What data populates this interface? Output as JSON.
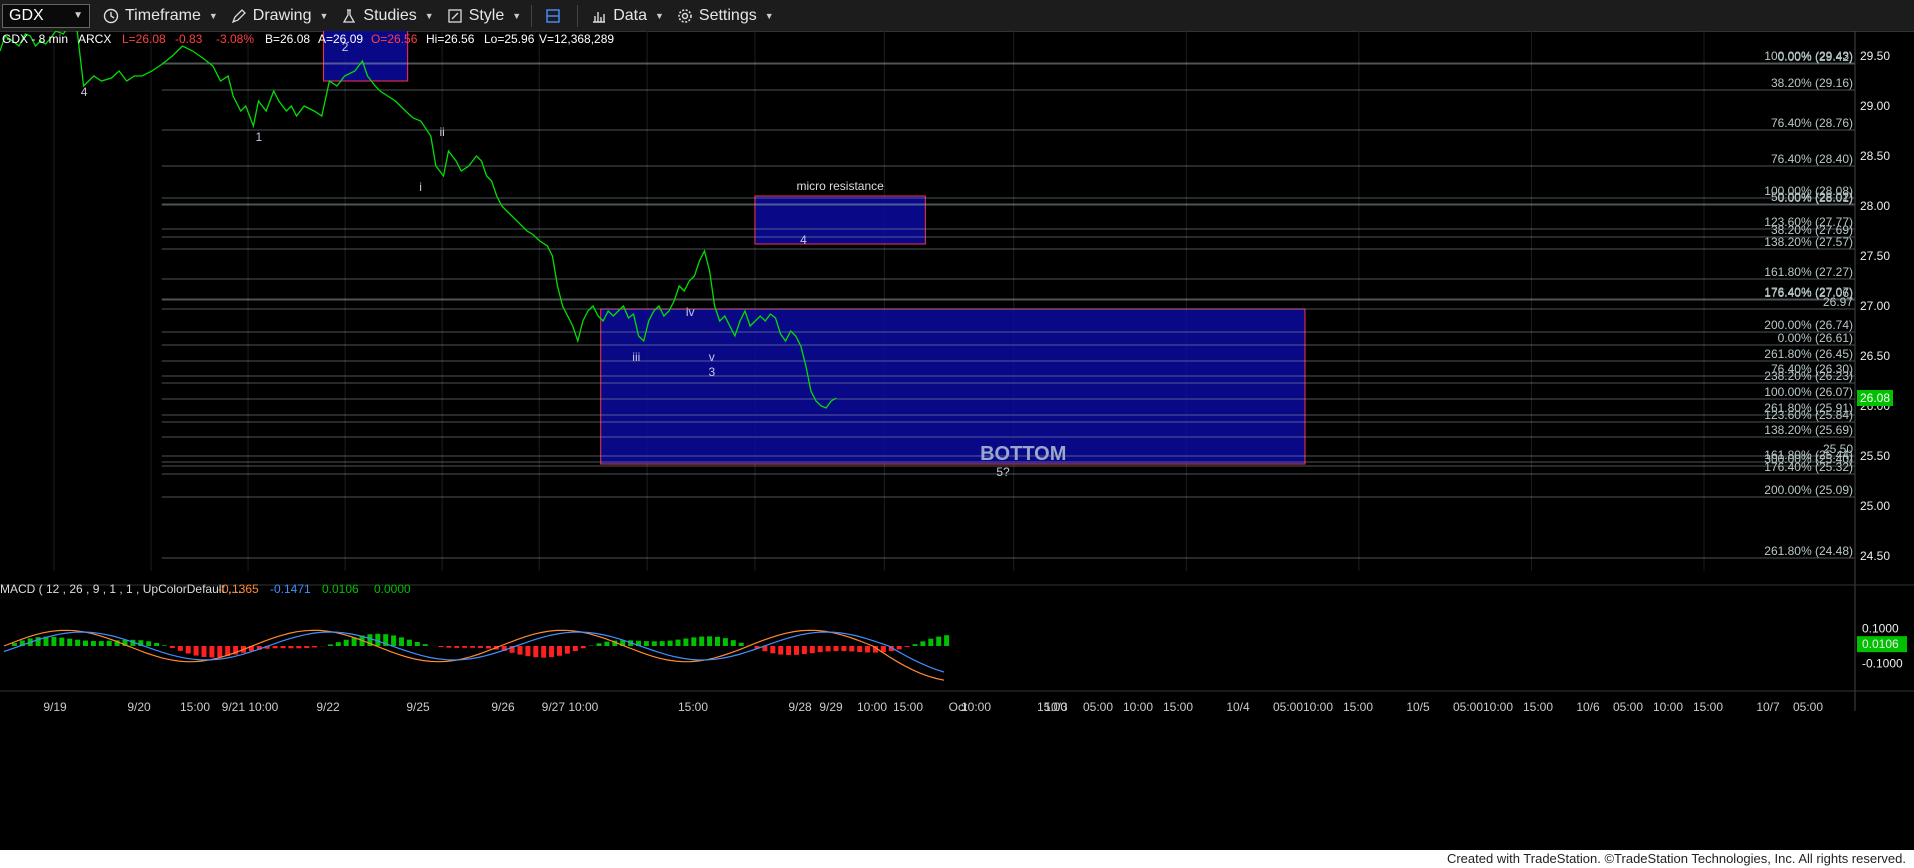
{
  "toolbar": {
    "symbol": "GDX",
    "timeframe_label": "Timeframe",
    "drawing_label": "Drawing",
    "studies_label": "Studies",
    "style_label": "Style",
    "data_label": "Data",
    "settings_label": "Settings",
    "icons": [
      "clock-icon",
      "pencil-icon",
      "flask-icon",
      "style-icon",
      "layout-icon",
      "bar-chart-icon",
      "gear-icon"
    ]
  },
  "header": {
    "symbol_interval": "GDX - 8 min",
    "exchange": "ARCX",
    "last": "L=26.08",
    "change": "-0.83",
    "change_pct": "-3.08%",
    "bid": "B=26.08",
    "ask": "A=26.09",
    "open": "O=26.56",
    "high": "Hi=26.56",
    "low": "Lo=25.96",
    "volume": "V=12,368,289"
  },
  "colors": {
    "price_line": "#00e000",
    "negative": "#ff4040",
    "box_fill": "#0a0aa0",
    "box_border": "#ff3050",
    "grid": "#1e1e1e",
    "last_tag": "#00c000",
    "macd_line": "#ff8a30",
    "signal_line": "#4090ff",
    "hist_pos": "#00c000",
    "hist_neg": "#ff2020"
  },
  "chart_data": {
    "type": "line",
    "title": "GDX - 8 min",
    "ylim": [
      24.35,
      29.75
    ],
    "y_ticks": [
      "29.50",
      "29.00",
      "28.50",
      "28.00",
      "27.50",
      "27.00",
      "26.50",
      "26.00",
      "25.50",
      "25.00",
      "24.50"
    ],
    "x_ticks": [
      "9/19",
      "9/20",
      "15:00",
      "9/21 10:00",
      "9/22",
      "9/25",
      "9/26",
      "9/27 10:00",
      "15:00",
      "9/28",
      "9/29",
      "10:00",
      "15:00",
      "Oct",
      "10:00",
      "15:00",
      "10/3",
      "05:00",
      "10:00",
      "15:00",
      "10/4",
      "05:00",
      "10:00",
      "15:00",
      "10/5",
      "05:00",
      "10:00",
      "15:00",
      "10/6",
      "05:00",
      "10:00",
      "15:00",
      "10/7",
      "05:00"
    ],
    "last_price_label": "26.08",
    "price_series": {
      "name": "GDX",
      "x": [
        0,
        0.02,
        0.05,
        0.075,
        0.1,
        0.12,
        0.14,
        0.16,
        0.18,
        0.2,
        0.22,
        0.25,
        0.27,
        0.3,
        0.33,
        0.37,
        0.4,
        0.44,
        0.47,
        0.5,
        0.53,
        0.56,
        0.6,
        0.64,
        0.68,
        0.72,
        0.76,
        0.8,
        0.84,
        0.87,
        0.9,
        0.92,
        0.95,
        0.97,
        1.0,
        1.02,
        1.05,
        1.08,
        1.1,
        1.13,
        1.15,
        1.17,
        1.2,
        1.24,
        1.27,
        1.3,
        1.33,
        1.36,
        1.4,
        1.43,
        1.45,
        1.48,
        1.5,
        1.53,
        1.56,
        1.58,
        1.6,
        1.63,
        1.66,
        1.7,
        1.72,
        1.75,
        1.77,
        1.8,
        1.82,
        1.85,
        1.88,
        1.9,
        1.92,
        1.94,
        1.96,
        1.98,
        2.0,
        2.02,
        2.04,
        2.06,
        2.08,
        2.1,
        2.13,
        2.16,
        2.18,
        2.2,
        2.22,
        2.24,
        2.26,
        2.28,
        2.3,
        2.32,
        2.34,
        2.36,
        2.38,
        2.4,
        2.42,
        2.44,
        2.46,
        2.48,
        2.5,
        2.52,
        2.54,
        2.56,
        2.58,
        2.6,
        2.62,
        2.64,
        2.66,
        2.68,
        2.7,
        2.72,
        2.74,
        2.76,
        2.78,
        2.8,
        2.82,
        2.84,
        2.86,
        2.88,
        2.9,
        2.92,
        2.94,
        2.96,
        2.98,
        3.0,
        3.02,
        3.04,
        3.06,
        3.08,
        3.1,
        3.12,
        3.14,
        3.16,
        3.18,
        3.2,
        3.22,
        3.24,
        3.26,
        3.28,
        3.3,
        3.32,
        3.34,
        3.36,
        3.38,
        3.4,
        3.42,
        3.44,
        3.46,
        3.48,
        3.5,
        3.52,
        3.54,
        3.56,
        3.58,
        3.6,
        3.62,
        3.64,
        3.66
      ],
      "y": [
        29.55,
        29.7,
        29.65,
        29.6,
        29.72,
        29.7,
        29.6,
        29.65,
        29.62,
        29.68,
        29.75,
        29.72,
        29.8,
        29.85,
        29.2,
        29.3,
        29.25,
        29.28,
        29.35,
        29.25,
        29.3,
        29.3,
        29.35,
        29.42,
        29.5,
        29.6,
        29.55,
        29.48,
        29.4,
        29.25,
        29.3,
        29.1,
        28.95,
        29.0,
        28.8,
        29.05,
        28.95,
        29.15,
        29.05,
        28.95,
        29.0,
        28.9,
        29.0,
        28.95,
        28.9,
        29.25,
        29.2,
        29.3,
        29.35,
        29.45,
        29.3,
        29.2,
        29.15,
        29.1,
        29.05,
        29.0,
        28.95,
        28.88,
        28.85,
        28.7,
        28.4,
        28.3,
        28.55,
        28.45,
        28.35,
        28.4,
        28.5,
        28.45,
        28.3,
        28.25,
        28.1,
        28.0,
        27.95,
        27.9,
        27.85,
        27.8,
        27.75,
        27.72,
        27.65,
        27.6,
        27.5,
        27.2,
        27.0,
        26.9,
        26.8,
        26.65,
        26.85,
        26.95,
        27.0,
        26.9,
        26.85,
        26.95,
        26.9,
        26.95,
        27.0,
        26.88,
        26.92,
        26.7,
        26.65,
        26.85,
        26.95,
        27.0,
        26.9,
        26.95,
        27.05,
        27.2,
        27.15,
        27.25,
        27.3,
        27.45,
        27.55,
        27.35,
        27.0,
        26.85,
        26.9,
        26.8,
        26.7,
        26.85,
        26.95,
        26.8,
        26.85,
        26.9,
        26.85,
        26.92,
        26.88,
        26.72,
        26.65,
        26.75,
        26.7,
        26.6,
        26.4,
        26.15,
        26.05,
        26.0,
        25.98,
        26.05,
        26.08
      ],
      "note_x": ""
    },
    "rectangles": [
      {
        "x0": 0.3,
        "x1": 0.378,
        "y0": 29.25,
        "y1": 29.85,
        "label": "2"
      },
      {
        "x0": 0.7,
        "x1": 0.858,
        "y0": 27.62,
        "y1": 28.1,
        "label": "micro resistance"
      },
      {
        "x0": 0.557,
        "x1": 1.21,
        "y0": 25.42,
        "y1": 26.97,
        "label": "BOTTOM"
      }
    ],
    "levels": [
      {
        "y": 29.43,
        "label": "100.00% (29.43)"
      },
      {
        "y": 29.42,
        "label": "0.00% (29.42)"
      },
      {
        "y": 29.16,
        "label": "38.20% (29.16)"
      },
      {
        "y": 28.76,
        "label": "76.40% (28.76)"
      },
      {
        "y": 28.4,
        "label": "76.40% (28.40)"
      },
      {
        "y": 28.01,
        "label": "0.00% (28.01)"
      },
      {
        "y": 28.08,
        "label": "100.00% (28.08)"
      },
      {
        "y": 28.02,
        "label": "50.00% (28.02)"
      },
      {
        "y": 27.77,
        "label": "123.60% (27.77)"
      },
      {
        "y": 27.69,
        "label": "38.20% (27.69)"
      },
      {
        "y": 27.57,
        "label": "138.20% (27.57)"
      },
      {
        "y": 27.27,
        "label": "161.80% (27.27)"
      },
      {
        "y": 27.07,
        "label": "176.40% (27.07)"
      },
      {
        "y": 27.06,
        "label": "176.40% (27.06)"
      },
      {
        "y": 26.97,
        "label": "26.97"
      },
      {
        "y": 26.74,
        "label": "200.00% (26.74)"
      },
      {
        "y": 26.61,
        "label": "0.00% (26.61)"
      },
      {
        "y": 26.45,
        "label": "261.80% (26.45)"
      },
      {
        "y": 26.3,
        "label": "76.40% (26.30)"
      },
      {
        "y": 26.23,
        "label": "238.20% (26.23)"
      },
      {
        "y": 26.07,
        "label": "100.00% (26.07)"
      },
      {
        "y": 25.91,
        "label": "261.80% (25.91)"
      },
      {
        "y": 25.84,
        "label": "123.60% (25.84)"
      },
      {
        "y": 25.69,
        "label": "138.20% (25.69)"
      },
      {
        "y": 25.5,
        "label": "25.50"
      },
      {
        "y": 25.44,
        "label": "161.80% (25.44)"
      },
      {
        "y": 25.4,
        "label": "300.00% (25.40)"
      },
      {
        "y": 25.32,
        "label": "176.40% (25.32)"
      },
      {
        "y": 25.09,
        "label": "200.00% (25.09)"
      },
      {
        "y": 24.48,
        "label": "261.80% (24.48)"
      }
    ],
    "wave_labels": [
      {
        "x": 0.078,
        "y": 29.1,
        "text": "4"
      },
      {
        "x": 0.24,
        "y": 28.65,
        "text": "1"
      },
      {
        "x": 0.32,
        "y": 29.55,
        "text": "2"
      },
      {
        "x": 0.41,
        "y": 28.7,
        "text": "ii"
      },
      {
        "x": 0.39,
        "y": 28.15,
        "text": "i"
      },
      {
        "x": 0.64,
        "y": 26.9,
        "text": "iv"
      },
      {
        "x": 0.59,
        "y": 26.45,
        "text": "iii"
      },
      {
        "x": 0.66,
        "y": 26.45,
        "text": "v"
      },
      {
        "x": 0.66,
        "y": 26.3,
        "text": "3"
      },
      {
        "x": 0.745,
        "y": 27.62,
        "text": "4"
      },
      {
        "x": 0.93,
        "y": 25.3,
        "text": "5?"
      }
    ],
    "macd": {
      "label": "MACD ( 12 , 26 , 9 , 1 , 1 , UpColorDefault ,...",
      "values_text": [
        "-0.1365",
        "-0.1471",
        "0.0106",
        "0.0000"
      ],
      "y_ticks": [
        "0.1000",
        "0.0106",
        "-0.1000"
      ],
      "ylim": [
        -0.2,
        0.2
      ]
    }
  },
  "footer": {
    "text": "Created with TradeStation. ©TradeStation Technologies, Inc. All rights reserved."
  }
}
